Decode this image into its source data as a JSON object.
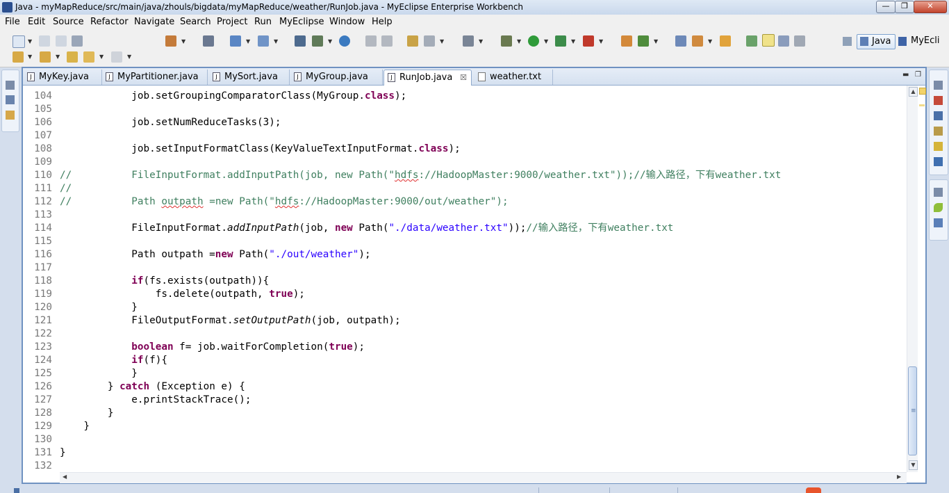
{
  "window": {
    "title": "Java - myMapReduce/src/main/java/zhouls/bigdata/myMapReduce/weather/RunJob.java - MyEclipse Enterprise Workbench",
    "minimize": "—",
    "maximize": "❐",
    "close": "✕"
  },
  "menu": {
    "items": [
      "File",
      "Edit",
      "Source",
      "Refactor",
      "Navigate",
      "Search",
      "Project",
      "Run",
      "MyEclipse",
      "Window",
      "Help"
    ]
  },
  "perspectives": {
    "java": "Java",
    "myeclipse": "MyEcli"
  },
  "tabs": [
    {
      "label": "MyKey.java",
      "active": false
    },
    {
      "label": "MyPartitioner.java",
      "active": false
    },
    {
      "label": "MySort.java",
      "active": false
    },
    {
      "label": "MyGroup.java",
      "active": false
    },
    {
      "label": "RunJob.java",
      "active": true,
      "close": "☒"
    },
    {
      "label": "weather.txt",
      "active": false
    }
  ],
  "colors": {
    "keyword": "#7f0055",
    "string": "#2a00ff",
    "comment": "#3f7f5f",
    "line_number": "#787878",
    "editor_border": "#6f92c1"
  },
  "editor": {
    "lines": [
      {
        "n": "104",
        "parts": [
          {
            "t": "            job.setGroupingComparatorClass(MyGroup."
          },
          {
            "t": "class",
            "c": "kw"
          },
          {
            "t": ");"
          }
        ]
      },
      {
        "n": "105",
        "parts": []
      },
      {
        "n": "106",
        "parts": [
          {
            "t": "            job.setNumReduceTasks(3);"
          }
        ]
      },
      {
        "n": "107",
        "parts": []
      },
      {
        "n": "108",
        "parts": [
          {
            "t": "            job.setInputFormatClass(KeyValueTextInputFormat."
          },
          {
            "t": "class",
            "c": "kw"
          },
          {
            "t": ");"
          }
        ]
      },
      {
        "n": "109",
        "parts": []
      },
      {
        "n": "110",
        "parts": [
          {
            "t": "//",
            "c": "cmt"
          },
          {
            "t": "          FileInputFormat.addInputPath(job, new Path(\"",
            "c": "cmt"
          },
          {
            "t": "hdfs",
            "c": "cmt squig"
          },
          {
            "t": "://HadoopMaster:9000/weather.txt\"));//输入路径，下有weather.txt",
            "c": "cmt"
          }
        ]
      },
      {
        "n": "111",
        "parts": [
          {
            "t": "//",
            "c": "cmt"
          }
        ]
      },
      {
        "n": "112",
        "parts": [
          {
            "t": "//",
            "c": "cmt"
          },
          {
            "t": "          Path ",
            "c": "cmt"
          },
          {
            "t": "outpath",
            "c": "cmt squig"
          },
          {
            "t": " =new Path(\"",
            "c": "cmt"
          },
          {
            "t": "hdfs",
            "c": "cmt squig"
          },
          {
            "t": "://HadoopMaster:9000/out/weather\");",
            "c": "cmt"
          }
        ]
      },
      {
        "n": "113",
        "parts": []
      },
      {
        "n": "114",
        "parts": [
          {
            "t": "            FileInputFormat."
          },
          {
            "t": "addInputPath",
            "c": "italic"
          },
          {
            "t": "(job, "
          },
          {
            "t": "new",
            "c": "kw"
          },
          {
            "t": " Path("
          },
          {
            "t": "\"./data/weather.txt\"",
            "c": "str"
          },
          {
            "t": "));"
          },
          {
            "t": "//输入路径，下有weather.txt",
            "c": "cmt"
          }
        ]
      },
      {
        "n": "115",
        "parts": []
      },
      {
        "n": "116",
        "parts": [
          {
            "t": "            Path outpath ="
          },
          {
            "t": "new",
            "c": "kw"
          },
          {
            "t": " Path("
          },
          {
            "t": "\"./out/weather\"",
            "c": "str"
          },
          {
            "t": ");"
          }
        ]
      },
      {
        "n": "117",
        "parts": []
      },
      {
        "n": "118",
        "parts": [
          {
            "t": "            "
          },
          {
            "t": "if",
            "c": "kw"
          },
          {
            "t": "(fs.exists(outpath)){"
          }
        ]
      },
      {
        "n": "119",
        "parts": [
          {
            "t": "                fs.delete(outpath, "
          },
          {
            "t": "true",
            "c": "kw"
          },
          {
            "t": ");"
          }
        ]
      },
      {
        "n": "120",
        "parts": [
          {
            "t": "            }"
          }
        ]
      },
      {
        "n": "121",
        "parts": [
          {
            "t": "            FileOutputFormat."
          },
          {
            "t": "setOutputPath",
            "c": "italic"
          },
          {
            "t": "(job, outpath);"
          }
        ]
      },
      {
        "n": "122",
        "parts": []
      },
      {
        "n": "123",
        "parts": [
          {
            "t": "            "
          },
          {
            "t": "boolean",
            "c": "kw"
          },
          {
            "t": " f= job.waitForCompletion("
          },
          {
            "t": "true",
            "c": "kw"
          },
          {
            "t": ");"
          }
        ]
      },
      {
        "n": "124",
        "parts": [
          {
            "t": "            "
          },
          {
            "t": "if",
            "c": "kw"
          },
          {
            "t": "(f){"
          }
        ]
      },
      {
        "n": "125",
        "parts": [
          {
            "t": "            }"
          }
        ]
      },
      {
        "n": "126",
        "parts": [
          {
            "t": "        } "
          },
          {
            "t": "catch",
            "c": "kw"
          },
          {
            "t": " (Exception e) {"
          }
        ]
      },
      {
        "n": "127",
        "parts": [
          {
            "t": "            e.printStackTrace();"
          }
        ]
      },
      {
        "n": "128",
        "parts": [
          {
            "t": "        }"
          }
        ]
      },
      {
        "n": "129",
        "parts": [
          {
            "t": "    }"
          }
        ]
      },
      {
        "n": "130",
        "parts": []
      },
      {
        "n": "131",
        "parts": [
          {
            "t": "}"
          }
        ]
      },
      {
        "n": "132",
        "parts": []
      }
    ]
  }
}
